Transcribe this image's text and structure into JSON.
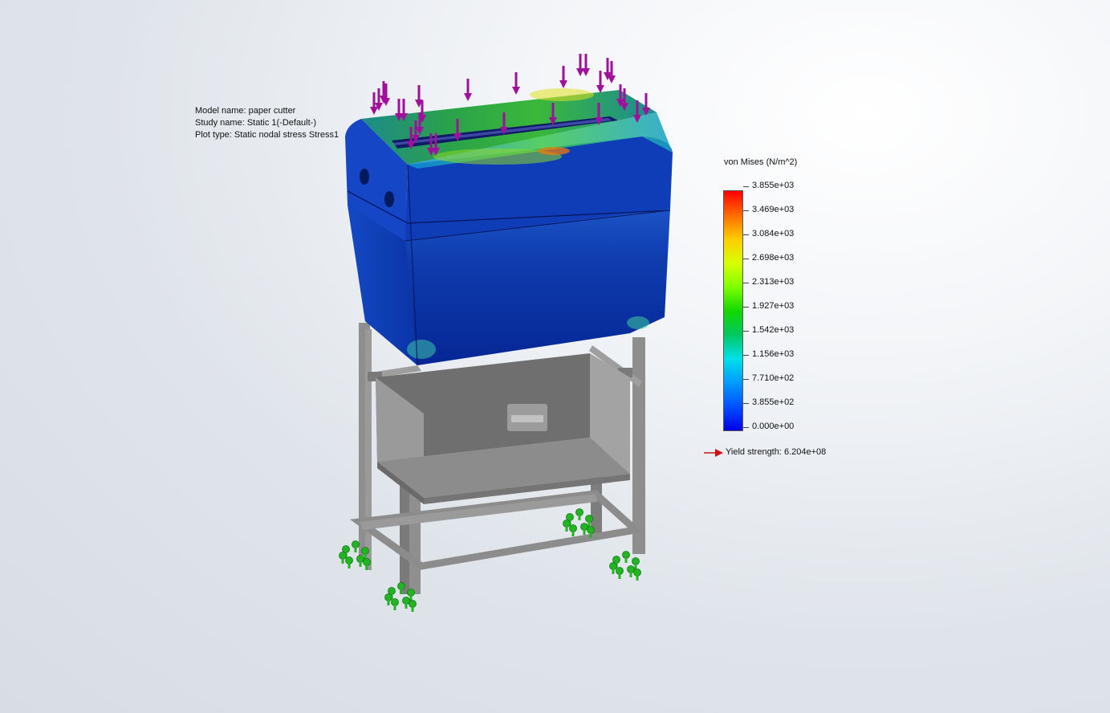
{
  "info": {
    "model_name": "Model name: paper cutter",
    "study_name": "Study name: Static 1(-Default-)",
    "plot_type": "Plot type: Static nodal stress Stress1"
  },
  "legend": {
    "title": "von Mises (N/m^2)",
    "ticks": [
      {
        "label": "3.855e+03",
        "value": 3855
      },
      {
        "label": "3.469e+03",
        "value": 3469
      },
      {
        "label": "3.084e+03",
        "value": 3084
      },
      {
        "label": "2.698e+03",
        "value": 2698
      },
      {
        "label": "2.313e+03",
        "value": 2313
      },
      {
        "label": "1.927e+03",
        "value": 1927
      },
      {
        "label": "1.542e+03",
        "value": 1542
      },
      {
        "label": "1.156e+03",
        "value": 1156
      },
      {
        "label": "7.710e+02",
        "value": 771
      },
      {
        "label": "3.855e+02",
        "value": 385.5
      },
      {
        "label": "0.000e+00",
        "value": 0
      }
    ],
    "yield_strength": "Yield strength: 6.204e+08"
  },
  "colors": {
    "arrow_load": "#a0109a",
    "fixture": "#22b422",
    "frame": "#8f8f8f",
    "bin": "#8a8a8a",
    "hopper_base": "#0a2a9c",
    "stress_high": "#ff0000",
    "stress_low": "#0000e6",
    "yield_marker": "#d01010"
  },
  "icons": {
    "load_arrow": "down-arrow-icon",
    "fixture": "fixed-geometry-icon",
    "yield": "right-arrow-icon"
  }
}
